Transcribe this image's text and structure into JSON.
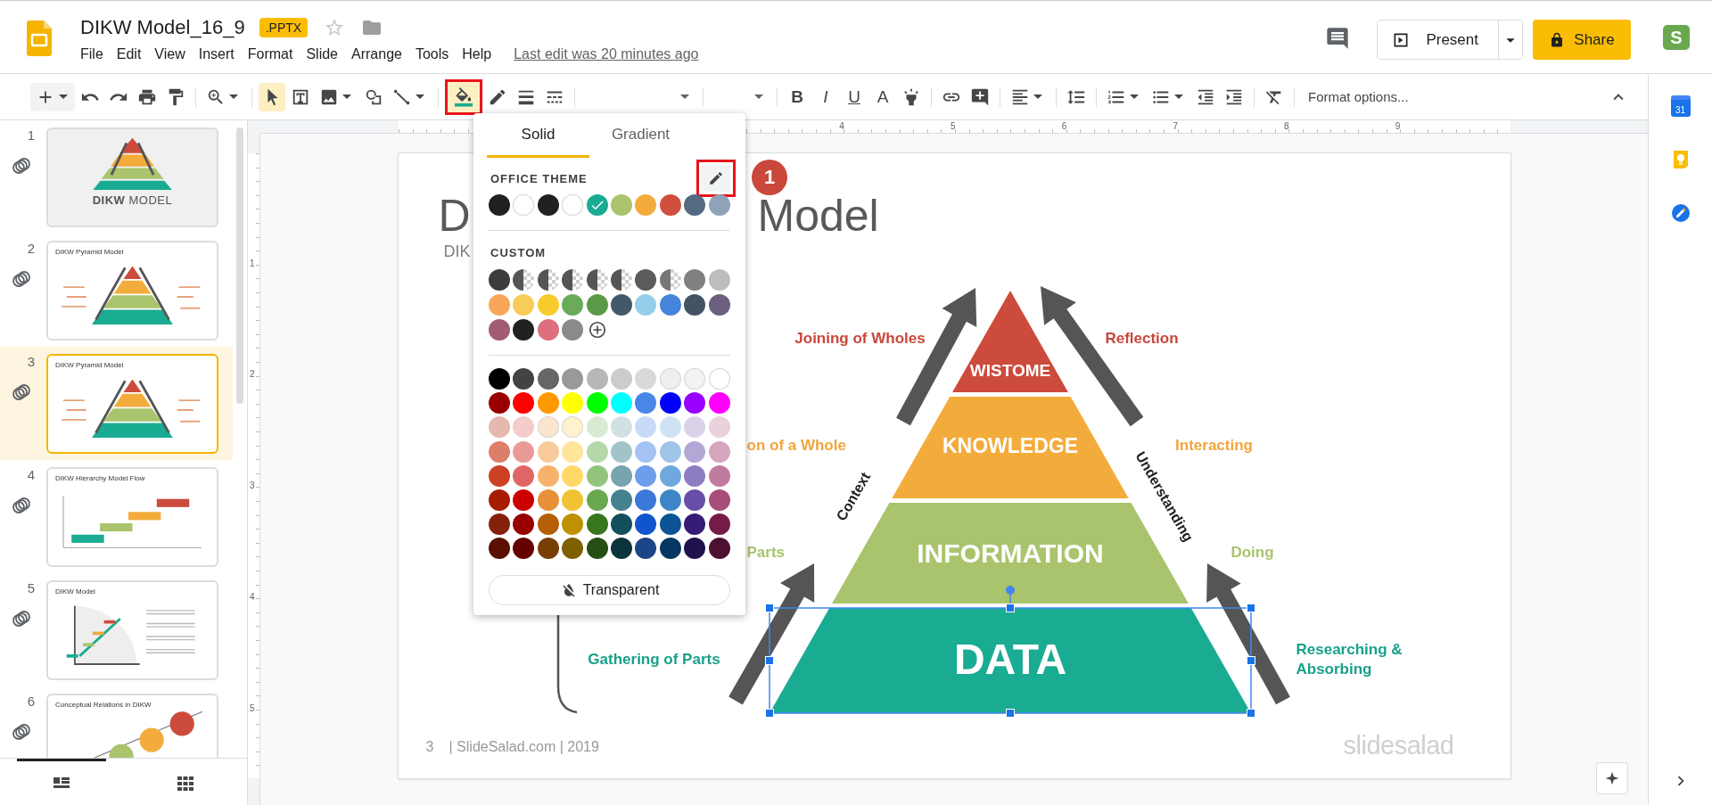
{
  "document": {
    "title": "DIKW Model_16_9",
    "badge": ".PPTX",
    "starred": false
  },
  "menu": [
    "File",
    "Edit",
    "View",
    "Insert",
    "Format",
    "Slide",
    "Arrange",
    "Tools",
    "Help"
  ],
  "last_edit": "Last edit was 20 minutes ago",
  "present_button": "Present",
  "share_button": "Share",
  "account": "S",
  "toolbar": [
    {
      "kind": "add",
      "caret": true,
      "selected": false
    },
    {
      "kind": "undo",
      "selected": false
    },
    {
      "kind": "redo",
      "selected": false
    },
    {
      "kind": "print",
      "selected": false
    },
    {
      "kind": "paintformat",
      "selected": false
    },
    {
      "kind": "sep"
    },
    {
      "kind": "zoom",
      "caret": true,
      "selected": false
    },
    {
      "kind": "sep"
    },
    {
      "kind": "select",
      "selected": true
    },
    {
      "kind": "textbox",
      "selected": false
    },
    {
      "kind": "image",
      "caret": true,
      "selected": false
    },
    {
      "kind": "shape",
      "selected": false
    },
    {
      "kind": "line",
      "caret": true,
      "selected": false
    },
    {
      "kind": "sep"
    },
    {
      "kind": "fill",
      "selected": true,
      "outlined": true
    },
    {
      "kind": "pencil",
      "selected": false
    },
    {
      "kind": "weight",
      "selected": false
    },
    {
      "kind": "dash",
      "selected": false
    },
    {
      "kind": "sep"
    },
    {
      "kind": "font"
    },
    {
      "kind": "sep"
    },
    {
      "kind": "size"
    },
    {
      "kind": "sep"
    },
    {
      "kind": "bold",
      "label": "B",
      "selected": false
    },
    {
      "kind": "italic",
      "label": "I",
      "selected": false
    },
    {
      "kind": "underline",
      "label": "U",
      "selected": false
    },
    {
      "kind": "textcolor",
      "label": "A",
      "selected": false
    },
    {
      "kind": "highlight",
      "selected": false
    },
    {
      "kind": "sep"
    },
    {
      "kind": "link",
      "selected": false
    },
    {
      "kind": "comment",
      "selected": false
    },
    {
      "kind": "sep"
    },
    {
      "kind": "align",
      "caret": true,
      "selected": false
    },
    {
      "kind": "sep"
    },
    {
      "kind": "spacing",
      "selected": false
    },
    {
      "kind": "sep"
    },
    {
      "kind": "numbered",
      "caret": true,
      "selected": false
    },
    {
      "kind": "bulleted",
      "caret": true,
      "selected": false
    },
    {
      "kind": "outdent",
      "selected": false
    },
    {
      "kind": "indent",
      "selected": false
    },
    {
      "kind": "sep"
    },
    {
      "kind": "clear",
      "selected": false
    },
    {
      "kind": "sep"
    },
    {
      "kind": "text",
      "label": "Format options..."
    }
  ],
  "filmstrip": {
    "slides": [
      {
        "number": "1",
        "title": "**DIKW** MODEL",
        "kind": "cover",
        "selected": false
      },
      {
        "number": "2",
        "title": "DIKW Pyramid Model",
        "kind": "pyramid",
        "selected": false
      },
      {
        "number": "3",
        "title": "DIKW Pyramid Model",
        "kind": "pyramid",
        "selected": true
      },
      {
        "number": "4",
        "title": "DIKW Hierarchy Model Flow",
        "kind": "flow",
        "selected": false
      },
      {
        "number": "5",
        "title": "DIKW Model",
        "kind": "quadrant",
        "selected": false
      },
      {
        "number": "6",
        "title": "Conceptual Relations in DIKW",
        "kind": "circles",
        "selected": false
      }
    ],
    "views": [
      {
        "kind": "list",
        "selected": true
      },
      {
        "kind": "grid",
        "selected": false
      }
    ]
  },
  "ruler": {
    "horizontal": [
      "4",
      "5",
      "6",
      "7",
      "8",
      "9"
    ],
    "vertical": [
      "1",
      "2",
      "3",
      "4",
      "5"
    ]
  },
  "slide": {
    "title_parts": [
      "D",
      "Model"
    ],
    "subtitle": "DIK",
    "tiers": [
      {
        "label": "WISTOME",
        "color": "#cc4b3c",
        "selected": false
      },
      {
        "label": "KNOWLEDGE",
        "color": "#f3ac3b",
        "selected": false
      },
      {
        "label": "INFORMATION",
        "color": "#a9c46c",
        "selected": false
      },
      {
        "label": "DATA",
        "color": "#1aab93",
        "selected": true
      }
    ],
    "side_labels": [
      {
        "text": "Joining of Wholes",
        "color": "#c8473a"
      },
      {
        "text": "Reflection",
        "color": "#c8473a"
      },
      {
        "text": "on of a Whole",
        "color": "#f3a53c"
      },
      {
        "text": "Interacting",
        "color": "#f3a53c"
      },
      {
        "text": "Parts",
        "color": "#a9c46c"
      },
      {
        "text": "Doing",
        "color": "#a9c46c"
      },
      {
        "text": "Gathering of Parts",
        "color": "#1aa08a"
      },
      {
        "text": "Researching & Absorbing",
        "color": "#1aa08a"
      }
    ],
    "axis_labels": [
      "Context",
      "Understanding"
    ],
    "footer_number": "3",
    "footer_text": "| SlideSalad.com | 2019",
    "logo": "slidesalad"
  },
  "fill_menu": {
    "tabs": [
      {
        "label": "Solid",
        "selected": true
      },
      {
        "label": "Gradient",
        "selected": false
      }
    ],
    "theme_title": "OFFICE THEME",
    "edit_outlined": true,
    "theme": [
      {
        "color": "#212121",
        "selected": false
      },
      {
        "color": "#ffffff",
        "selected": false
      },
      {
        "color": "#212121",
        "selected": false
      },
      {
        "color": "#ffffff",
        "selected": false
      },
      {
        "color": "#1aab93",
        "selected": true
      },
      {
        "color": "#a9c46c",
        "selected": false
      },
      {
        "color": "#f3ac3b",
        "selected": false
      },
      {
        "color": "#d14f3e",
        "selected": false
      },
      {
        "color": "#546a80",
        "selected": false
      },
      {
        "color": "#8fa3b8",
        "selected": false
      }
    ],
    "custom_title": "CUSTOM",
    "custom": [
      {
        "color": "#3c3c3c",
        "kind": "solid"
      },
      {
        "color": "#555555",
        "kind": "half"
      },
      {
        "color": "#555555",
        "kind": "half"
      },
      {
        "color": "#555555",
        "kind": "half"
      },
      {
        "color": "#555555",
        "kind": "half"
      },
      {
        "color": "#555555",
        "kind": "half"
      },
      {
        "color": "#5b5b5b",
        "kind": "solid"
      },
      {
        "color": "#777777",
        "kind": "half"
      },
      {
        "color": "#808080",
        "kind": "solid"
      },
      {
        "color": "#bdbdbd",
        "kind": "solid"
      },
      {
        "color": "#f9a65a",
        "kind": "solid"
      },
      {
        "color": "#f8cc5a",
        "kind": "solid"
      },
      {
        "color": "#f6cb2b",
        "kind": "solid"
      },
      {
        "color": "#6aaa5a",
        "kind": "solid"
      },
      {
        "color": "#5a9a47",
        "kind": "solid"
      },
      {
        "color": "#43596a",
        "kind": "solid"
      },
      {
        "color": "#93cfea",
        "kind": "solid"
      },
      {
        "color": "#4585dc",
        "kind": "solid"
      },
      {
        "color": "#425366",
        "kind": "solid"
      },
      {
        "color": "#6a5f7e",
        "kind": "solid"
      },
      {
        "color": "#a25c74",
        "kind": "solid"
      },
      {
        "color": "#212121",
        "kind": "solid"
      },
      {
        "color": "#dd6f7e",
        "kind": "solid"
      },
      {
        "color": "#8a8a8a",
        "kind": "solid"
      }
    ],
    "standard": [
      {
        "color": "#000000"
      },
      {
        "color": "#434343"
      },
      {
        "color": "#666666"
      },
      {
        "color": "#999999"
      },
      {
        "color": "#b7b7b7"
      },
      {
        "color": "#cccccc"
      },
      {
        "color": "#d9d9d9"
      },
      {
        "color": "#efefef"
      },
      {
        "color": "#f3f3f3"
      },
      {
        "color": "#ffffff"
      },
      {
        "color": "#980000"
      },
      {
        "color": "#ff0000"
      },
      {
        "color": "#ff9900"
      },
      {
        "color": "#ffff00"
      },
      {
        "color": "#00ff00"
      },
      {
        "color": "#00ffff"
      },
      {
        "color": "#4a86e8"
      },
      {
        "color": "#0000ff"
      },
      {
        "color": "#9900ff"
      },
      {
        "color": "#ff00ff"
      },
      {
        "color": "#e6b8af"
      },
      {
        "color": "#f4cccc"
      },
      {
        "color": "#fce5cd"
      },
      {
        "color": "#fff2cc"
      },
      {
        "color": "#d9ead3"
      },
      {
        "color": "#d0e0e3"
      },
      {
        "color": "#c9daf8"
      },
      {
        "color": "#cfe2f3"
      },
      {
        "color": "#d9d2e9"
      },
      {
        "color": "#ead1dc"
      },
      {
        "color": "#dd7e6b"
      },
      {
        "color": "#ea9999"
      },
      {
        "color": "#f9cb9c"
      },
      {
        "color": "#ffe599"
      },
      {
        "color": "#b6d7a8"
      },
      {
        "color": "#a2c4c9"
      },
      {
        "color": "#a4c2f4"
      },
      {
        "color": "#9fc5e8"
      },
      {
        "color": "#b4a7d6"
      },
      {
        "color": "#d5a6bd"
      },
      {
        "color": "#cc4125"
      },
      {
        "color": "#e06666"
      },
      {
        "color": "#f6b26b"
      },
      {
        "color": "#ffd966"
      },
      {
        "color": "#93c47d"
      },
      {
        "color": "#76a5af"
      },
      {
        "color": "#6d9eeb"
      },
      {
        "color": "#6fa8dc"
      },
      {
        "color": "#8e7cc3"
      },
      {
        "color": "#c27ba0"
      },
      {
        "color": "#a61c00"
      },
      {
        "color": "#cc0000"
      },
      {
        "color": "#e69138"
      },
      {
        "color": "#f1c232"
      },
      {
        "color": "#6aa84f"
      },
      {
        "color": "#45818e"
      },
      {
        "color": "#3c78d8"
      },
      {
        "color": "#3d85c6"
      },
      {
        "color": "#674ea7"
      },
      {
        "color": "#a64d79"
      },
      {
        "color": "#85200c"
      },
      {
        "color": "#990000"
      },
      {
        "color": "#b45f06"
      },
      {
        "color": "#bf9000"
      },
      {
        "color": "#38761d"
      },
      {
        "color": "#134f5c"
      },
      {
        "color": "#1155cc"
      },
      {
        "color": "#0b5394"
      },
      {
        "color": "#351c75"
      },
      {
        "color": "#741b47"
      },
      {
        "color": "#5b0f00"
      },
      {
        "color": "#660000"
      },
      {
        "color": "#783f04"
      },
      {
        "color": "#7f6000"
      },
      {
        "color": "#274e13"
      },
      {
        "color": "#0c343d"
      },
      {
        "color": "#1c4587"
      },
      {
        "color": "#073763"
      },
      {
        "color": "#20124d"
      },
      {
        "color": "#4c1130"
      }
    ],
    "transparent": "Transparent"
  },
  "step_badge": "1",
  "side_panel": {
    "calendar_day": "31"
  }
}
